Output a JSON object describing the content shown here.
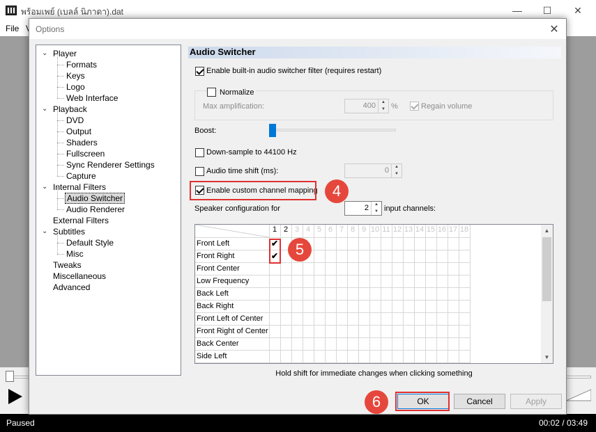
{
  "window": {
    "title": "พร้อมเพย์ (เบลล์ นิภาดา).dat",
    "menu": [
      "File",
      "V"
    ]
  },
  "dialog": {
    "title": "Options",
    "tree": [
      {
        "label": "Player",
        "level": 0,
        "toggle": "v"
      },
      {
        "label": "Formats",
        "level": 1
      },
      {
        "label": "Keys",
        "level": 1
      },
      {
        "label": "Logo",
        "level": 1
      },
      {
        "label": "Web Interface",
        "level": 1
      },
      {
        "label": "Playback",
        "level": 0,
        "toggle": "v"
      },
      {
        "label": "DVD",
        "level": 1
      },
      {
        "label": "Output",
        "level": 1
      },
      {
        "label": "Shaders",
        "level": 1
      },
      {
        "label": "Fullscreen",
        "level": 1
      },
      {
        "label": "Sync Renderer Settings",
        "level": 1
      },
      {
        "label": "Capture",
        "level": 1
      },
      {
        "label": "Internal Filters",
        "level": 0,
        "toggle": "v"
      },
      {
        "label": "Audio Switcher",
        "level": 1,
        "selected": true
      },
      {
        "label": "Audio Renderer",
        "level": 1
      },
      {
        "label": "External Filters",
        "level": 0
      },
      {
        "label": "Subtitles",
        "level": 0,
        "toggle": "v"
      },
      {
        "label": "Default Style",
        "level": 1
      },
      {
        "label": "Misc",
        "level": 1
      },
      {
        "label": "Tweaks",
        "level": 0
      },
      {
        "label": "Miscellaneous",
        "level": 0
      },
      {
        "label": "Advanced",
        "level": 0
      }
    ],
    "panel": {
      "title": "Audio Switcher",
      "enable_filter": {
        "label": "Enable built-in audio switcher filter (requires restart)",
        "checked": true
      },
      "normalize": {
        "label": "Normalize",
        "checked": false
      },
      "max_amp": {
        "label": "Max amplification:",
        "value": "400",
        "unit": "%"
      },
      "regain": {
        "label": "Regain volume",
        "checked": true
      },
      "boost": {
        "label": "Boost:",
        "level": 0
      },
      "downsample": {
        "label": "Down-sample to 44100 Hz",
        "checked": false
      },
      "time_shift": {
        "label": "Audio time shift (ms):",
        "checked": false,
        "value": "0"
      },
      "custom_mapping": {
        "label": "Enable custom channel mapping",
        "checked": true
      },
      "speaker_config": {
        "label": "Speaker configuration for",
        "value": "2",
        "suffix": "input channels:"
      },
      "grid": {
        "columns": [
          "1",
          "2",
          "3",
          "4",
          "5",
          "6",
          "7",
          "8",
          "9",
          "10",
          "11",
          "12",
          "13",
          "14",
          "15",
          "16",
          "17",
          "18"
        ],
        "active_columns": 2,
        "rows": [
          "Front Left",
          "Front Right",
          "Front Center",
          "Low Frequency",
          "Back Left",
          "Back Right",
          "Front Left of Center",
          "Front Right of Center",
          "Back Center",
          "Side Left"
        ],
        "checks": [
          [
            0,
            0
          ],
          [
            1,
            0
          ]
        ],
        "check_glyph": "✔"
      },
      "hint": "Hold shift for immediate changes when clicking something"
    },
    "buttons": {
      "ok": "OK",
      "cancel": "Cancel",
      "apply": "Apply"
    }
  },
  "annotations": [
    "4",
    "5",
    "6"
  ],
  "status": {
    "text": "Paused",
    "time": "00:02 / 03:49"
  },
  "colors": {
    "accent": "#0078d7",
    "annotation": "#e6473c"
  }
}
